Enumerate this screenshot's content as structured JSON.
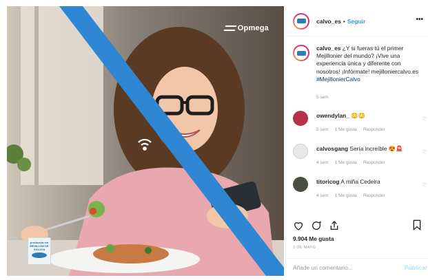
{
  "brand": {
    "name": "Opmega"
  },
  "badge": {
    "line1": "produzido em",
    "line2": "MEXILLÓN DE",
    "line3": "GALICIA"
  },
  "header": {
    "username": "calvo_es",
    "separator": "•",
    "follow_label": "Seguir",
    "more_icon": "more-icon"
  },
  "caption": {
    "username": "calvo_es",
    "text": "¿Y si fueras tú el primer Mejillonier del mundo? ¡Vive una experiencia única y diferente con nosotros! ¡Infórmate! mejilloniercalvo.es",
    "hashtag": "#MejillonierCalvo",
    "time": "5 sem"
  },
  "comments": [
    {
      "username": "owendylan_",
      "text": "😳😳",
      "time": "5 sem",
      "likes": "1 Me gusta",
      "reply": "Responder",
      "avatar_color": "#b4324a"
    },
    {
      "username": "calvosgang",
      "text": "Sería increíble 😍🚨",
      "time": "4 sem",
      "likes": "1 Me gusta",
      "reply": "Responder",
      "avatar_color": "#e9e9e9"
    },
    {
      "username": "titoricog",
      "text": "A miña Cedeira",
      "time": "4 sem",
      "likes": "1 Me gusta",
      "reply": "Responder",
      "avatar_color": "#4a4f44"
    }
  ],
  "actions": {
    "like_icon": "heart-icon",
    "comment_icon": "comment-icon",
    "share_icon": "share-icon",
    "save_icon": "bookmark-icon"
  },
  "likes": "9.904 Me gusta",
  "date": "3 DE MAYO",
  "add_comment": {
    "placeholder": "Añade un comentario...",
    "publish_label": "Publicar"
  },
  "colors": {
    "accent": "#3897f0",
    "stripe": "#2f86d2",
    "muted": "#999999"
  }
}
